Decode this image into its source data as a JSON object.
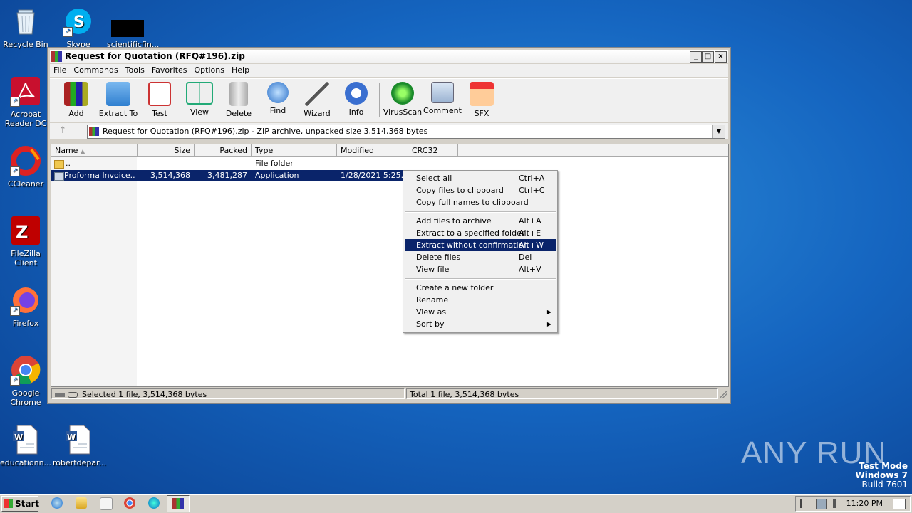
{
  "desktop": {
    "icons": [
      {
        "label": "Recycle Bin"
      },
      {
        "label": "Skype"
      },
      {
        "label": "scientificfin..."
      },
      {
        "label": "Acrobat Reader DC"
      },
      {
        "label": "CCleaner"
      },
      {
        "label": "FileZilla Client"
      },
      {
        "label": "Firefox"
      },
      {
        "label": "Google Chrome"
      },
      {
        "label": "educationn..."
      },
      {
        "label": "robertdepar..."
      }
    ]
  },
  "window": {
    "title": "Request for Quotation (RFQ#196).zip",
    "controls": {
      "minimize": "_",
      "maximize": "□",
      "close": "×"
    },
    "menu": [
      "File",
      "Commands",
      "Tools",
      "Favorites",
      "Options",
      "Help"
    ],
    "toolbar": [
      {
        "label": "Add",
        "icon": "add-archive-icon"
      },
      {
        "label": "Extract To",
        "icon": "extract-folder-icon"
      },
      {
        "label": "Test",
        "icon": "test-clipboard-icon"
      },
      {
        "label": "View",
        "icon": "view-book-icon"
      },
      {
        "label": "Delete",
        "icon": "trash-icon"
      },
      {
        "label": "Find",
        "icon": "magnifier-icon"
      },
      {
        "label": "Wizard",
        "icon": "wand-icon"
      },
      {
        "label": "Info",
        "icon": "info-icon"
      },
      {
        "label": "VirusScan",
        "icon": "virus-scan-icon"
      },
      {
        "label": "Comment",
        "icon": "comment-icon"
      },
      {
        "label": "SFX",
        "icon": "sfx-box-icon"
      }
    ],
    "address": "Request for Quotation (RFQ#196).zip - ZIP archive, unpacked size 3,514,368 bytes",
    "columns": [
      "Name",
      "Size",
      "Packed",
      "Type",
      "Modified",
      "CRC32"
    ],
    "rows": [
      {
        "name": "..",
        "size": "",
        "packed": "",
        "type": "File folder",
        "modified": "",
        "crc": ""
      },
      {
        "name": "Proforma Invoice...",
        "size": "3,514,368",
        "packed": "3,481,287",
        "type": "Application",
        "modified": "1/28/2021 5:25...",
        "crc": ""
      }
    ],
    "status_left": "Selected 1 file, 3,514,368 bytes",
    "status_right": "Total 1 file, 3,514,368 bytes"
  },
  "context_menu": {
    "groups": [
      [
        {
          "label": "Select all",
          "shortcut": "Ctrl+A"
        },
        {
          "label": "Copy files to clipboard",
          "shortcut": "Ctrl+C"
        },
        {
          "label": "Copy full names to clipboard",
          "shortcut": ""
        }
      ],
      [
        {
          "label": "Add files to archive",
          "shortcut": "Alt+A"
        },
        {
          "label": "Extract to a specified folder",
          "shortcut": "Alt+E"
        },
        {
          "label": "Extract without confirmation",
          "shortcut": "Alt+W",
          "highlighted": true
        },
        {
          "label": "Delete files",
          "shortcut": "Del"
        },
        {
          "label": "View file",
          "shortcut": "Alt+V"
        }
      ],
      [
        {
          "label": "Create a new folder",
          "shortcut": ""
        },
        {
          "label": "Rename",
          "shortcut": ""
        },
        {
          "label": "View as",
          "shortcut": "",
          "submenu": true
        },
        {
          "label": "Sort by",
          "shortcut": "",
          "submenu": true
        }
      ]
    ]
  },
  "taskbar": {
    "start": "Start",
    "clock": "11:20 PM"
  },
  "watermark": {
    "brand": "ANY RUN",
    "line1": "Test Mode",
    "line2": "Windows 7",
    "line3": "Build 7601"
  }
}
